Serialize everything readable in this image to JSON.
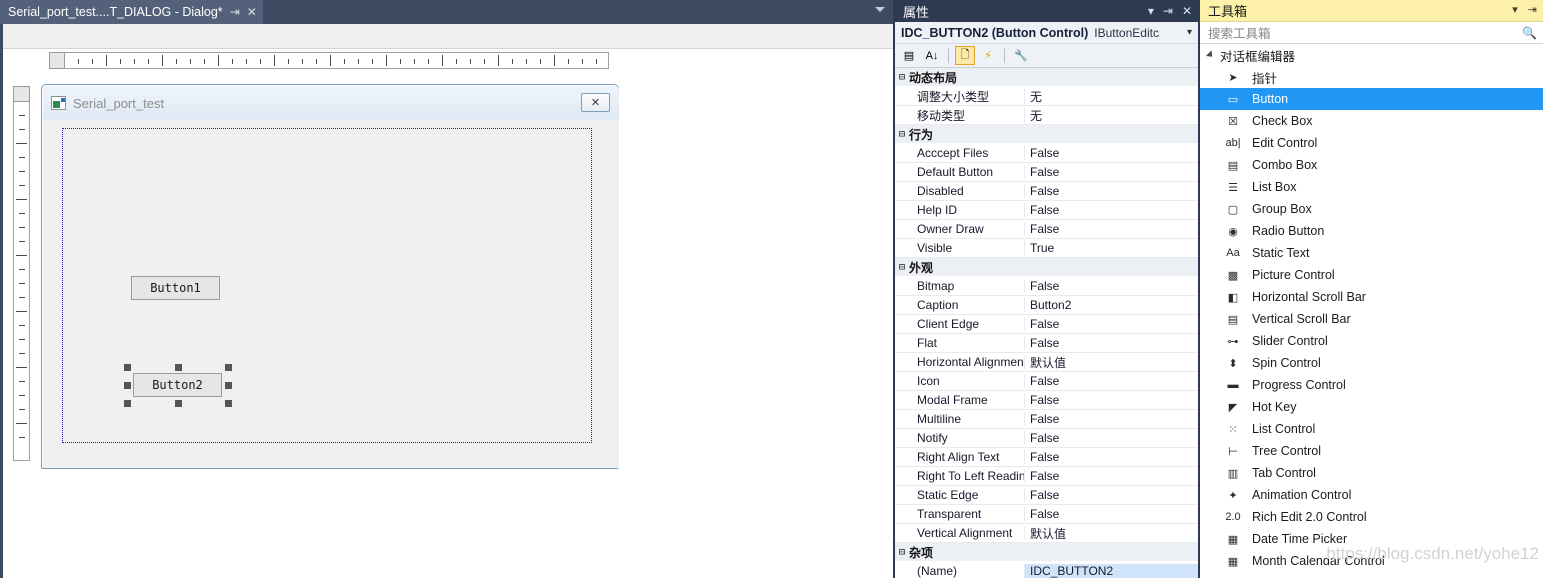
{
  "editor": {
    "tab": {
      "title": "Serial_port_test....T_DIALOG - Dialog*",
      "pin_icon": "⇥",
      "close_icon": "✕",
      "dropdown_icon": "chevron-down-icon"
    },
    "dialog": {
      "title": "Serial_port_test",
      "close_label": "✕",
      "app_icon": "app-icon",
      "buttons": [
        {
          "label": "Button1",
          "selected": false
        },
        {
          "label": "Button2",
          "selected": true
        }
      ]
    }
  },
  "properties": {
    "panel_title": "属性",
    "header_buttons": {
      "dropdown": "▾",
      "pin": "⇥",
      "close": "✕"
    },
    "object_name": "IDC_BUTTON2 (Button Control)",
    "object_type": "IButtonEditc",
    "object_arrow": "▾",
    "toolbar": [
      {
        "name": "categorized-view-icon",
        "glyph": "▤",
        "selected": false
      },
      {
        "name": "alphabetical-view-icon",
        "glyph": "A↓",
        "selected": false
      },
      {
        "name": "property-pages-icon",
        "glyph": "🗋",
        "selected": true
      },
      {
        "name": "events-icon",
        "glyph": "⚡",
        "selected": false
      },
      {
        "name": "wrench-icon",
        "glyph": "🔧",
        "selected": false
      }
    ],
    "groups": [
      {
        "name": "动态布局",
        "rows": [
          {
            "name": "调整大小类型",
            "value": "无"
          },
          {
            "name": "移动类型",
            "value": "无"
          }
        ]
      },
      {
        "name": "行为",
        "rows": [
          {
            "name": "Acccept Files",
            "value": "False"
          },
          {
            "name": "Default Button",
            "value": "False"
          },
          {
            "name": "Disabled",
            "value": "False"
          },
          {
            "name": "Help ID",
            "value": "False"
          },
          {
            "name": "Owner Draw",
            "value": "False"
          },
          {
            "name": "Visible",
            "value": "True"
          }
        ]
      },
      {
        "name": "外观",
        "rows": [
          {
            "name": "Bitmap",
            "value": "False"
          },
          {
            "name": "Caption",
            "value": "Button2"
          },
          {
            "name": "Client Edge",
            "value": "False"
          },
          {
            "name": "Flat",
            "value": "False"
          },
          {
            "name": "Horizontal Alignment",
            "value": "默认值"
          },
          {
            "name": "Icon",
            "value": "False"
          },
          {
            "name": "Modal Frame",
            "value": "False"
          },
          {
            "name": "Multiline",
            "value": "False"
          },
          {
            "name": "Notify",
            "value": "False"
          },
          {
            "name": "Right Align Text",
            "value": "False"
          },
          {
            "name": "Right To Left Reading",
            "value": "False"
          },
          {
            "name": "Static Edge",
            "value": "False"
          },
          {
            "name": "Transparent",
            "value": "False"
          },
          {
            "name": "Vertical Alignment",
            "value": "默认值"
          }
        ]
      },
      {
        "name": "杂项",
        "rows": [
          {
            "name": "(Name)",
            "value": "IDC_BUTTON2",
            "cut_off": true
          }
        ]
      }
    ]
  },
  "toolbox": {
    "panel_title": "工具箱",
    "header_buttons": {
      "dropdown": "▾",
      "pin": "⇥"
    },
    "search_placeholder": "搜索工具箱",
    "search_icon": "search-icon",
    "group_label": "对话框编辑器",
    "items": [
      {
        "label": "指针",
        "icon": "pointer-icon",
        "glyph": "➤",
        "selected": false
      },
      {
        "label": "Button",
        "icon": "button-icon",
        "glyph": "▭",
        "selected": true
      },
      {
        "label": "Check Box",
        "icon": "checkbox-icon",
        "glyph": "☒",
        "selected": false
      },
      {
        "label": "Edit Control",
        "icon": "edit-control-icon",
        "glyph": "ab|",
        "selected": false
      },
      {
        "label": "Combo Box",
        "icon": "combo-box-icon",
        "glyph": "▤",
        "selected": false
      },
      {
        "label": "List Box",
        "icon": "list-box-icon",
        "glyph": "☰",
        "selected": false
      },
      {
        "label": "Group Box",
        "icon": "group-box-icon",
        "glyph": "▢",
        "selected": false
      },
      {
        "label": "Radio Button",
        "icon": "radio-button-icon",
        "glyph": "◉",
        "selected": false
      },
      {
        "label": "Static Text",
        "icon": "static-text-icon",
        "glyph": "Aa",
        "selected": false
      },
      {
        "label": "Picture Control",
        "icon": "picture-control-icon",
        "glyph": "▩",
        "selected": false
      },
      {
        "label": "Horizontal Scroll Bar",
        "icon": "horizontal-scroll-bar-icon",
        "glyph": "◧",
        "selected": false
      },
      {
        "label": "Vertical Scroll Bar",
        "icon": "vertical-scroll-bar-icon",
        "glyph": "▤",
        "selected": false
      },
      {
        "label": "Slider Control",
        "icon": "slider-control-icon",
        "glyph": "⊶",
        "selected": false
      },
      {
        "label": "Spin Control",
        "icon": "spin-control-icon",
        "glyph": "⬍",
        "selected": false
      },
      {
        "label": "Progress Control",
        "icon": "progress-control-icon",
        "glyph": "▬",
        "selected": false
      },
      {
        "label": "Hot Key",
        "icon": "hot-key-icon",
        "glyph": "◤",
        "selected": false
      },
      {
        "label": "List Control",
        "icon": "list-control-icon",
        "glyph": "⁙",
        "selected": false
      },
      {
        "label": "Tree Control",
        "icon": "tree-control-icon",
        "glyph": "⊢",
        "selected": false
      },
      {
        "label": "Tab Control",
        "icon": "tab-control-icon",
        "glyph": "▥",
        "selected": false
      },
      {
        "label": "Animation Control",
        "icon": "animation-control-icon",
        "glyph": "✦",
        "selected": false
      },
      {
        "label": "Rich Edit 2.0 Control",
        "icon": "rich-edit-icon",
        "glyph": "2.0",
        "selected": false
      },
      {
        "label": "Date Time Picker",
        "icon": "date-time-picker-icon",
        "glyph": "▦",
        "selected": false
      },
      {
        "label": "Month Calendar Control",
        "icon": "month-calendar-icon",
        "glyph": "▦",
        "selected": false
      }
    ]
  },
  "watermark": "https://blog.csdn.net/yohe12"
}
